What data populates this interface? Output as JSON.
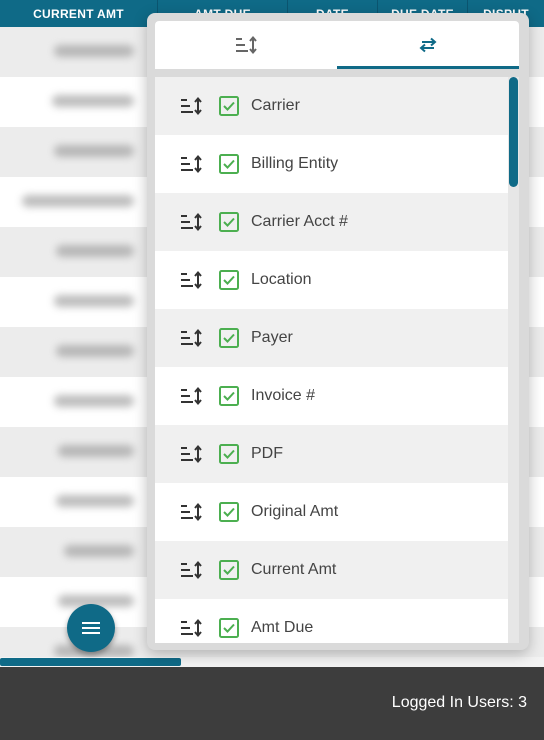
{
  "table": {
    "headers": [
      "CURRENT AMT",
      "AMT DUE",
      "DATE",
      "DUE DATE",
      "DISPUT"
    ]
  },
  "column_chooser": {
    "tabs": [
      {
        "icon": "sort-order-icon",
        "active": false
      },
      {
        "icon": "swap-horizontal-icon",
        "active": true
      }
    ],
    "columns": [
      {
        "label": "Carrier",
        "checked": true
      },
      {
        "label": "Billing Entity",
        "checked": true
      },
      {
        "label": "Carrier Acct #",
        "checked": true
      },
      {
        "label": "Location",
        "checked": true
      },
      {
        "label": "Payer",
        "checked": true
      },
      {
        "label": "Invoice #",
        "checked": true
      },
      {
        "label": "PDF",
        "checked": true
      },
      {
        "label": "Original Amt",
        "checked": true
      },
      {
        "label": "Current Amt",
        "checked": true
      },
      {
        "label": "Amt Due",
        "checked": true
      }
    ]
  },
  "fab": {
    "icon": "menu-icon"
  },
  "footer": {
    "status": "Logged In Users: 3"
  },
  "colors": {
    "accent": "#0f6a87",
    "check": "#4caf50",
    "footer": "#3d3d3d"
  }
}
